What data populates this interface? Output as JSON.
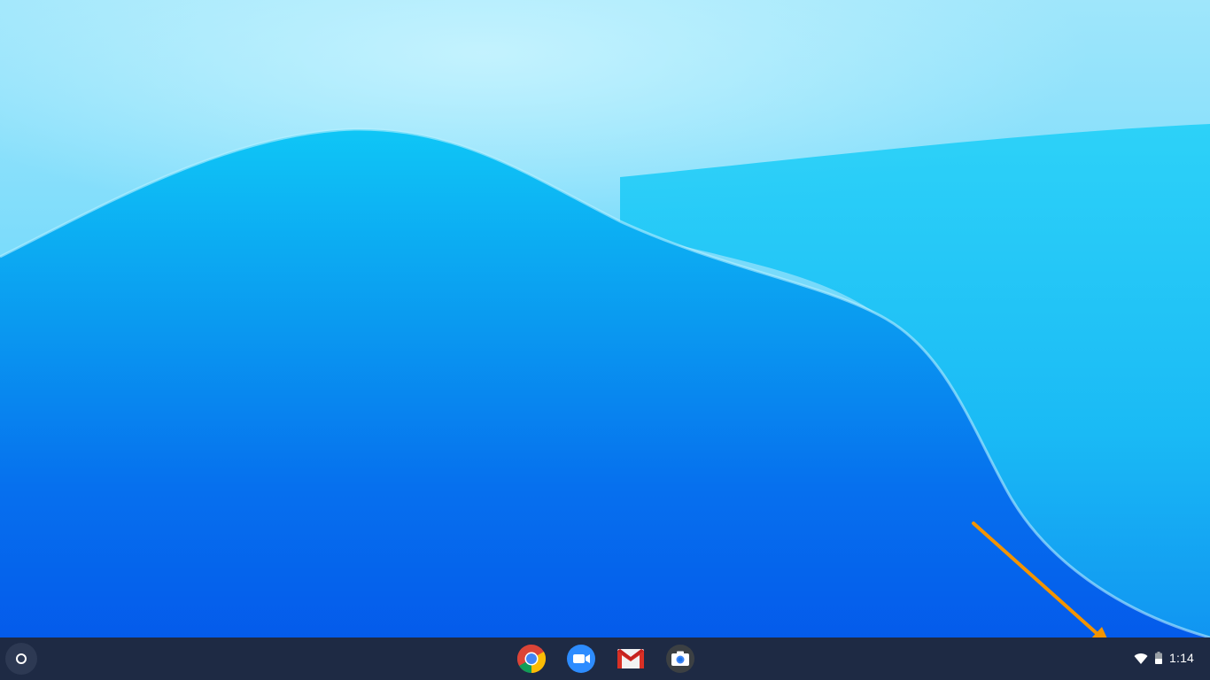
{
  "desktop": {
    "wallpaper": "blue-wave-wallpaper"
  },
  "shelf": {
    "launcher": {
      "icon": "launcher-circle-icon"
    },
    "apps": [
      {
        "id": "chrome",
        "icon": "chrome-icon"
      },
      {
        "id": "zoom",
        "icon": "zoom-icon"
      },
      {
        "id": "gmail",
        "icon": "gmail-icon"
      },
      {
        "id": "camera",
        "icon": "camera-icon"
      }
    ],
    "status_tray": {
      "wifi_icon": "wifi-icon",
      "battery_icon": "battery-icon",
      "time": "1:14"
    }
  },
  "annotation": {
    "highlight_color": "#f39400",
    "target": "status-tray"
  },
  "colors": {
    "shelf_bg": "#1e2a44",
    "accent_orange": "#f39400"
  }
}
